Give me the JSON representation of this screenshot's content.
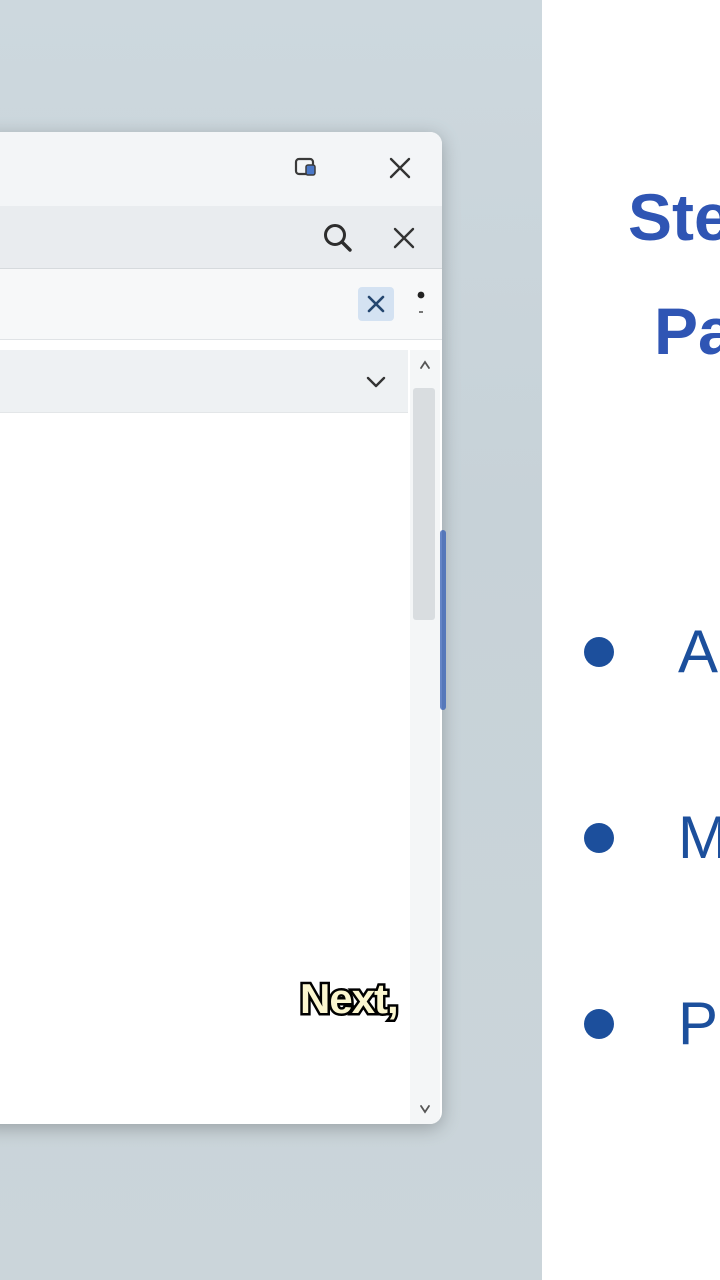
{
  "slide": {
    "title_line1": "Ste",
    "title_line2": "Pa",
    "bullets": [
      {
        "text": "A"
      },
      {
        "text": "M"
      },
      {
        "text": "P"
      }
    ]
  },
  "window": {
    "titlebar_icons": [
      "snap-layout-icon",
      "close-icon"
    ],
    "searchbar_icons": [
      "search-icon",
      "close-search-icon"
    ],
    "filter_icons": [
      "clear-filter-icon",
      "more-options-icon"
    ],
    "dropdown_icon": "chevron-down-icon"
  },
  "caption": {
    "text": "Next,"
  },
  "colors": {
    "slide_title": "#2f55b4",
    "bullet": "#1c4f9c",
    "caption_fill": "#fbf6cf"
  }
}
